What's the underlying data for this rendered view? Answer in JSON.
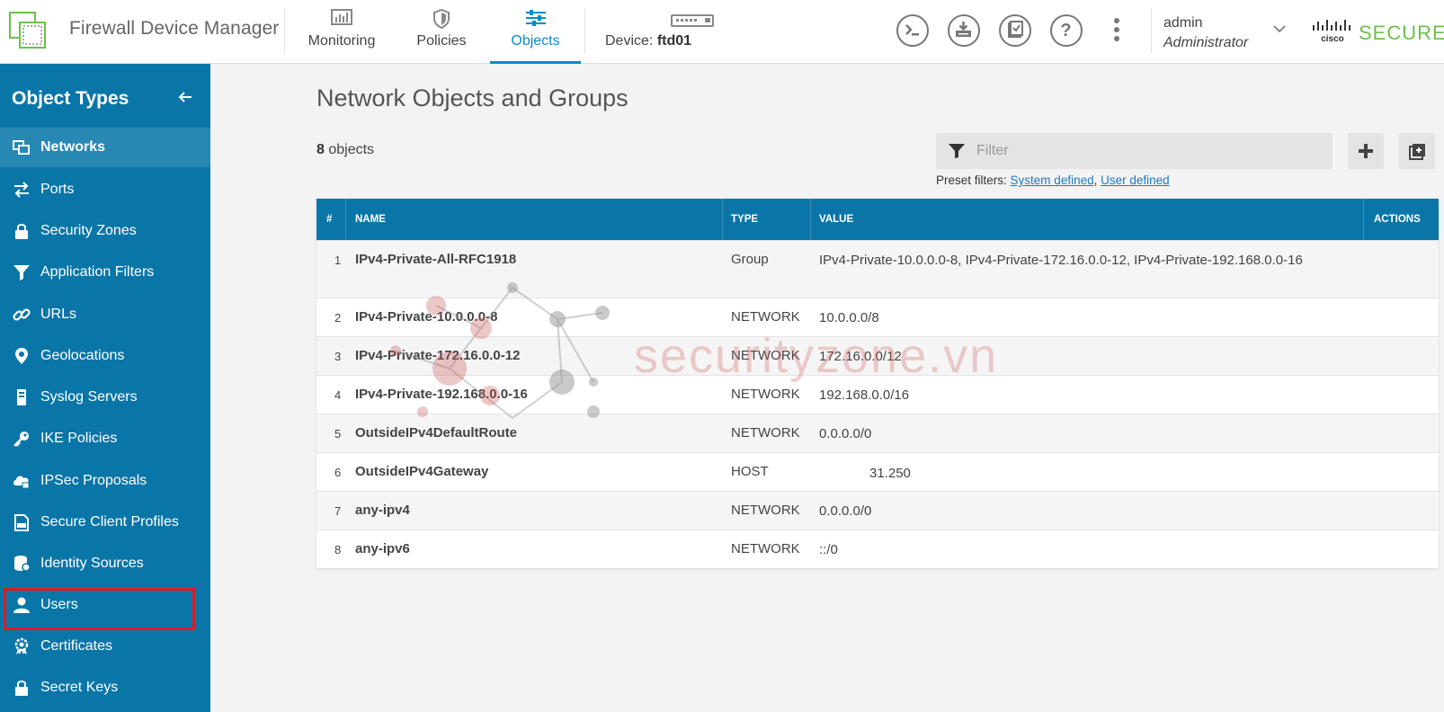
{
  "header": {
    "app_title": "Firewall Device Manager",
    "nav_tabs": [
      {
        "label": "Monitoring",
        "icon": "monitoring-icon",
        "active": false
      },
      {
        "label": "Policies",
        "icon": "policies-icon",
        "active": false
      },
      {
        "label": "Objects",
        "icon": "objects-icon",
        "active": true
      }
    ],
    "device_label": "Device:",
    "device_name": "ftd01",
    "user": {
      "name": "admin",
      "role": "Administrator"
    },
    "brand": {
      "vendor": "cisco",
      "product": "SECURE"
    },
    "accent_color": "#0a8ac7"
  },
  "sidebar": {
    "title": "Object Types",
    "items": [
      {
        "label": "Networks",
        "icon": "networks-icon",
        "active": true
      },
      {
        "label": "Ports",
        "icon": "ports-icon"
      },
      {
        "label": "Security Zones",
        "icon": "lock-icon"
      },
      {
        "label": "Application Filters",
        "icon": "application-filter-icon"
      },
      {
        "label": "URLs",
        "icon": "link-icon"
      },
      {
        "label": "Geolocations",
        "icon": "location-pin-icon"
      },
      {
        "label": "Syslog Servers",
        "icon": "server-icon"
      },
      {
        "label": "IKE Policies",
        "icon": "key-icon"
      },
      {
        "label": "IPSec Proposals",
        "icon": "cloud-lock-icon"
      },
      {
        "label": "Secure Client Profiles",
        "icon": "client-profile-icon"
      },
      {
        "label": "Identity Sources",
        "icon": "database-icon"
      },
      {
        "label": "Users",
        "icon": "user-icon",
        "highlighted": true
      },
      {
        "label": "Certificates",
        "icon": "certificate-icon"
      },
      {
        "label": "Secret Keys",
        "icon": "lock-icon"
      }
    ],
    "bg_color": "#0a76a8",
    "highlight_color": "#e01b22"
  },
  "main": {
    "title": "Network Objects and Groups",
    "count_number": "8",
    "count_suffix": "objects",
    "filter_placeholder": "Filter",
    "preset_label": "Preset filters:",
    "preset_links": [
      "System defined",
      "User defined"
    ],
    "table": {
      "columns": [
        "#",
        "NAME",
        "TYPE",
        "VALUE",
        "ACTIONS"
      ],
      "rows": [
        {
          "num": "1",
          "name": "IPv4-Private-All-RFC1918",
          "type": "Group",
          "value": "IPv4-Private-10.0.0.0-8, IPv4-Private-172.16.0.0-12, IPv4-Private-192.168.0.0-16"
        },
        {
          "num": "2",
          "name": "IPv4-Private-10.0.0.0-8",
          "type": "NETWORK",
          "value": "10.0.0.0/8"
        },
        {
          "num": "3",
          "name": "IPv4-Private-172.16.0.0-12",
          "type": "NETWORK",
          "value": "172.16.0.0/12"
        },
        {
          "num": "4",
          "name": "IPv4-Private-192.168.0.0-16",
          "type": "NETWORK",
          "value": "192.168.0.0/16"
        },
        {
          "num": "5",
          "name": "OutsideIPv4DefaultRoute",
          "type": "NETWORK",
          "value": "0.0.0.0/0"
        },
        {
          "num": "6",
          "name": "OutsideIPv4Gateway",
          "type": "HOST",
          "value": "31.250",
          "value_masked": true
        },
        {
          "num": "7",
          "name": "any-ipv4",
          "type": "NETWORK",
          "value": "0.0.0.0/0"
        },
        {
          "num": "8",
          "name": "any-ipv6",
          "type": "NETWORK",
          "value": "::/0"
        }
      ]
    }
  },
  "watermark": {
    "text": "securityzone.vn"
  }
}
